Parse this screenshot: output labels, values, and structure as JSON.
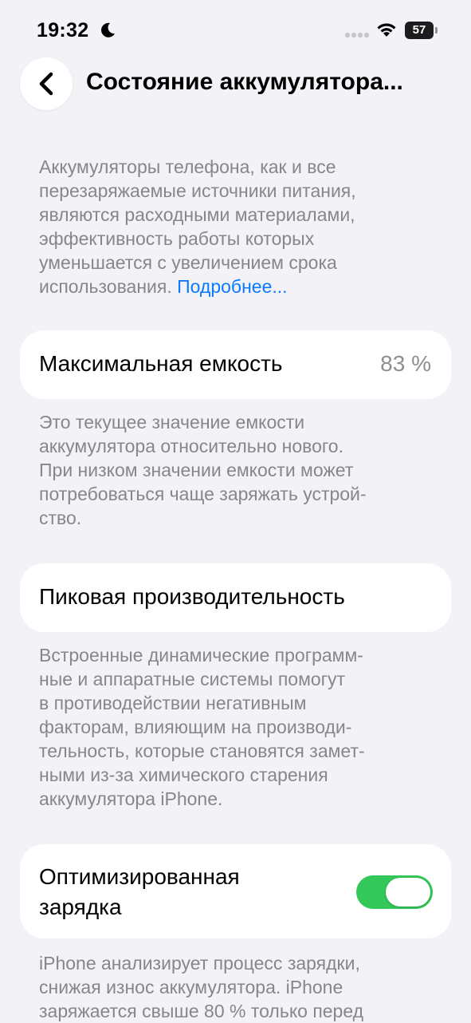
{
  "status_bar": {
    "time": "19:32",
    "battery_level": "57",
    "icons": [
      "moon-icon",
      "signal-icon",
      "wifi-icon",
      "battery-icon"
    ]
  },
  "nav": {
    "back_icon": "chevron-left-icon",
    "title": "Состояние аккумулятора..."
  },
  "intro": {
    "lines": [
      "Аккумуляторы телефона, как и все",
      "перезаряжаемые источники питания,",
      "являются расходными материалами,",
      "эффективность работы которых",
      "уменьшается с увеличением срока",
      "использования. "
    ],
    "link_text": "Подробнее..."
  },
  "max_capacity": {
    "label": "Максимальная емкость",
    "value": "83 %",
    "description_lines": [
      "Это текущее значение емкости",
      "аккумулятора относительно нового.",
      "При низком значении емкости может",
      "потребоваться чаще заряжать устрой-",
      "ство."
    ]
  },
  "peak_performance": {
    "label": "Пиковая производительность",
    "description_lines": [
      "Встроенные динамические программ-",
      "ные и аппаратные системы помогут",
      "в противодействии негативным",
      "факторам, влияющим на производи-",
      "тельность, которые становятся замет-",
      "ными из-за химического старения",
      "аккумулятора iPhone."
    ]
  },
  "optimized_charging": {
    "label_lines": [
      "Оптимизированная",
      "зарядка"
    ],
    "toggle_on": true,
    "toggle_color": "#34c759",
    "description_lines": [
      "iPhone анализирует процесс зарядки,",
      "снижая износ аккумулятора. iPhone",
      "заряжается свыше 80 % только перед"
    ]
  },
  "colors": {
    "background": "#f2f2f7",
    "card": "#ffffff",
    "secondary_text": "#86868b",
    "link": "#0a7aff"
  }
}
